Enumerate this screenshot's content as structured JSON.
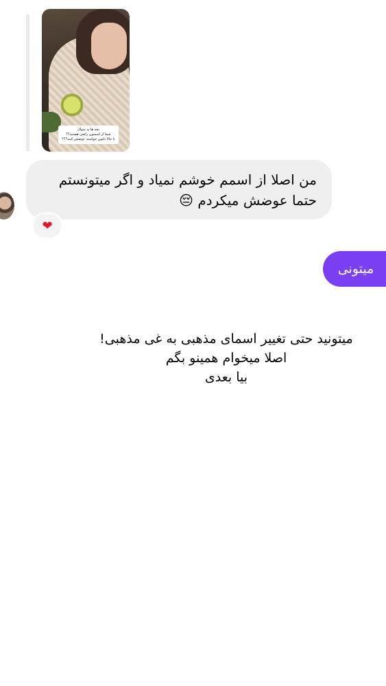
{
  "story_reply": {
    "caption_lines": [
      "بچه ها یه سوال",
      "شما از اسمتون راضی هستید؟؟",
      "تا حالا دلتون خواسته عوضش کنید؟؟؟"
    ],
    "thumbnail_icon": "story-photo"
  },
  "incoming_message": {
    "line1": "من اصلا از اسمم خوشم نمیاد و اگر میتونستم",
    "line2": "حتما عوضش میکردم 😔",
    "reaction": "❤"
  },
  "outgoing_message": {
    "text": "میتونی"
  },
  "overlay_note": {
    "line1": "میتونید حتی تغییر اسمای مذهبی به غی مذهبی!",
    "line2": "اصلا میخوام  همینو بگم",
    "line3": "بیا بعدی"
  }
}
